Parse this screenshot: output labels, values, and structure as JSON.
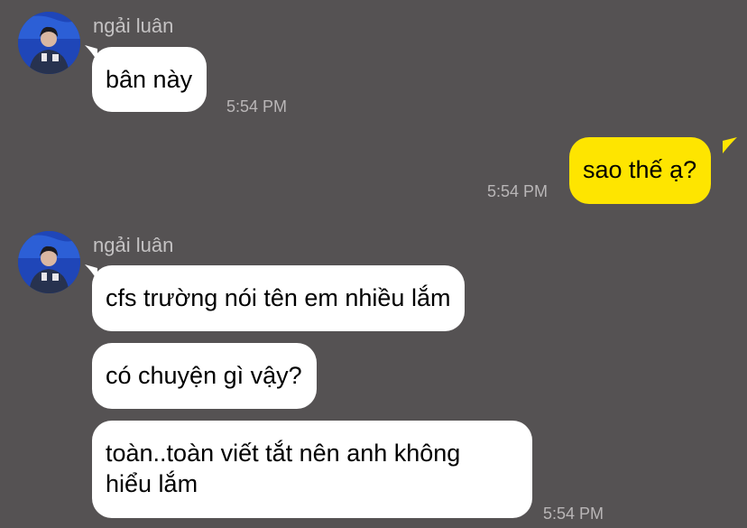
{
  "messages": [
    {
      "sender": "ngải luân",
      "direction": "incoming",
      "avatar_icon": "profile-photo-avatar",
      "texts": [
        "bân này"
      ],
      "time": "5:54 PM"
    },
    {
      "direction": "outgoing",
      "texts": [
        "sao thế ạ?"
      ],
      "time": "5:54 PM"
    },
    {
      "sender": "ngải luân",
      "direction": "incoming",
      "avatar_icon": "profile-photo-avatar",
      "texts": [
        "cfs trường nói tên em nhiều lắm",
        "có chuyện gì vậy?",
        "toàn..toàn viết tắt nên anh không\nhiểu lắm"
      ],
      "time": "5:54 PM"
    }
  ],
  "colors": {
    "background": "#555253",
    "incoming_bubble": "#ffffff",
    "outgoing_bubble": "#fee500",
    "meta_text": "#b9b6b7"
  }
}
